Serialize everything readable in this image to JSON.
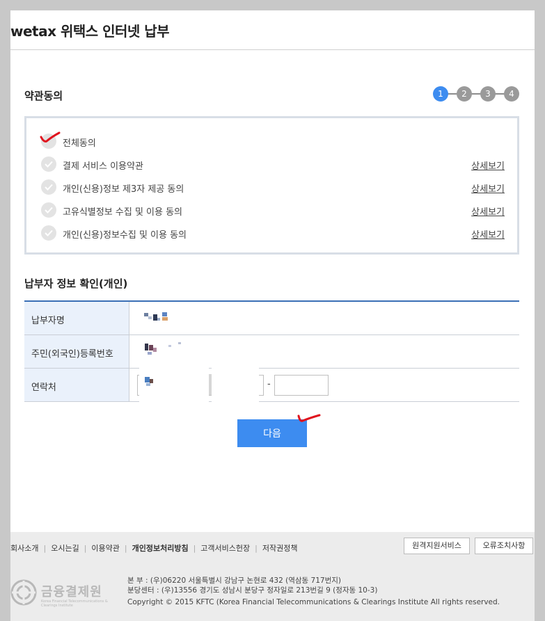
{
  "header": {
    "title": "wetax 위택스 인터넷 납부"
  },
  "terms": {
    "title": "약관동의",
    "steps": [
      "1",
      "2",
      "3",
      "4"
    ],
    "all_label": "전체동의",
    "items": [
      {
        "label": "결제 서비스 이용약관",
        "link": "상세보기"
      },
      {
        "label": "개인(신용)정보 제3자 제공 동의",
        "link": "상세보기"
      },
      {
        "label": "고유식별정보 수집 및 이용 동의",
        "link": "상세보기"
      },
      {
        "label": "개인(신용)정보수집 및 이용 동의",
        "link": "상세보기"
      }
    ]
  },
  "payer": {
    "title": "납부자 정보 확인(개인)",
    "name_label": "납부자명",
    "id_label": "주민(외국인)등록번호",
    "phone_label": "연락처",
    "phone_dash": "-"
  },
  "next_button": "다음",
  "footer": {
    "links": [
      "회사소개",
      "오시는길",
      "이용약관",
      "개인정보처리방침",
      "고객서비스헌장",
      "저작권정책"
    ],
    "remote_button": "원격지원서비스",
    "error_button": "오류조치사항",
    "logo_name": "금융결제원",
    "logo_sub": "Korea Financial Telecommunications & Clearings Institute",
    "address_1": "본 부 : (우)06220 서울특별시 강남구 논현로 432 (역삼동 717번지)",
    "address_2": "분당센터 : (우)13556 경기도 성남시 분당구 정자일로 213번길 9 (정자동 10-3)",
    "copyright": "Copyright © 2015 KFTC (Korea Financial Telecommunications & Clearings Institute All rights reserved."
  },
  "colors": {
    "accent": "#3d8cf0",
    "table_border": "#3a6fb5",
    "annotation": "#e0141e"
  }
}
